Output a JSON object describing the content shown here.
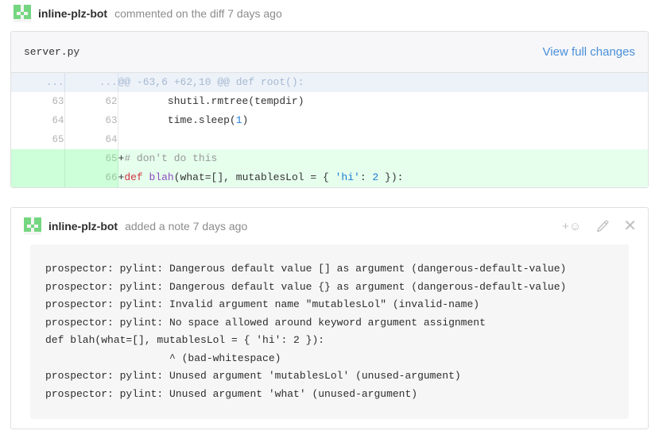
{
  "theme": {
    "link_color": "#4a90d9",
    "addition_bg": "#e6ffed",
    "addition_gutter_bg": "#cdffd8",
    "hunk_bg": "#edf2f9",
    "avatar_color": "#74d680",
    "note_code_bg": "#f6f6f6",
    "border_color": "#e0e0e0"
  },
  "diff_comment": {
    "avatar_name": "identicon-avatar",
    "author": "inline-plz-bot",
    "action_text": "commented on the diff 7 days ago"
  },
  "diff_card": {
    "file_name": "server.py",
    "view_full_changes_label": "View full changes",
    "rows": [
      {
        "type": "hunk",
        "old": "...",
        "new": "...",
        "code": "@@ -63,6 +62,10 @@ def root():"
      },
      {
        "type": "context",
        "old": "63",
        "new": "62",
        "code": "        shutil.rmtree(tempdir)"
      },
      {
        "type": "context",
        "old": "64",
        "new": "63",
        "code": "        time.sleep(1)"
      },
      {
        "type": "context",
        "old": "65",
        "new": "64",
        "code": ""
      },
      {
        "type": "addition",
        "old": "",
        "new": "65",
        "code": "+# don't do this"
      },
      {
        "type": "addition",
        "old": "",
        "new": "66",
        "code": "+def blah(what=[], mutablesLol = { 'hi': 2 }):"
      }
    ]
  },
  "note": {
    "avatar_name": "identicon-avatar",
    "author": "inline-plz-bot",
    "action_text": "added a note 7 days ago",
    "actions": [
      {
        "name": "add-reaction-button",
        "glyph": "+☺"
      },
      {
        "name": "edit-note-button",
        "glyph": "✎"
      },
      {
        "name": "close-note-button",
        "glyph": "✕"
      }
    ],
    "body_lines": [
      "prospector: pylint: Dangerous default value [] as argument (dangerous-default-value)",
      "prospector: pylint: Dangerous default value {} as argument (dangerous-default-value)",
      "prospector: pylint: Invalid argument name \"mutablesLol\" (invalid-name)",
      "prospector: pylint: No space allowed around keyword argument assignment",
      "def blah(what=[], mutablesLol = { 'hi': 2 }):",
      "                    ^ (bad-whitespace)",
      "prospector: pylint: Unused argument 'mutablesLol' (unused-argument)",
      "prospector: pylint: Unused argument 'what' (unused-argument)"
    ]
  }
}
